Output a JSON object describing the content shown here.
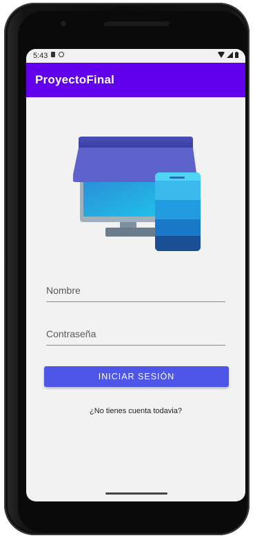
{
  "status_bar": {
    "time": "5:43"
  },
  "app_bar": {
    "title": "ProyectoFinal"
  },
  "logo": {
    "icon": "desktop-and-phone-illustration"
  },
  "form": {
    "name_placeholder": "Nombre",
    "name_value": "",
    "password_placeholder": "Contraseña",
    "password_value": "",
    "login_label": "INICIAR SESIÓN",
    "register_link": "¿No tienes cuenta todavia?"
  },
  "colors": {
    "app_bar": "#6200ee",
    "button": "#4e56e8",
    "background": "#f2f2f2"
  }
}
